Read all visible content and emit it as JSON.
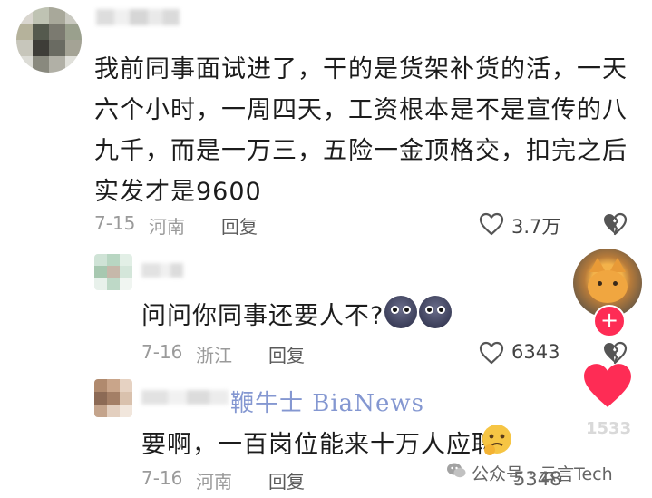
{
  "comments": [
    {
      "text": "我前同事面试进了，干的是货架补货的活，一天六个小时，一周四天，工资根本是不是宣传的八九千，而是一万三，五险一金顶格交，扣完之后实发才是9600",
      "date": "7-15",
      "location": "河南",
      "reply_label": "回复",
      "like_count": "3.7万"
    },
    {
      "text": "问问你同事还要人不?",
      "date": "7-16",
      "location": "浙江",
      "reply_label": "回复",
      "like_count": "6343"
    },
    {
      "text": "要啊，一百岗位能来十万人应聘",
      "date": "7-16",
      "location": "河南",
      "reply_label": "回复",
      "like_count": "5348"
    }
  ],
  "sidebar": {
    "like_count": "1533",
    "follow_symbol": "+"
  },
  "watermarks": {
    "brand": "鞭牛士 BiaNews",
    "wechat": "公众号 · 云言Tech"
  },
  "icons": {
    "like": "heart-outline-icon",
    "dislike": "broken-heart-icon",
    "side_like": "heart-filled-icon",
    "follow": "plus-icon",
    "wechat": "wechat-icon"
  },
  "colors": {
    "accent_red": "#fe2c55",
    "meta_gray": "#9a9a9a",
    "text": "#1c1c1c"
  }
}
